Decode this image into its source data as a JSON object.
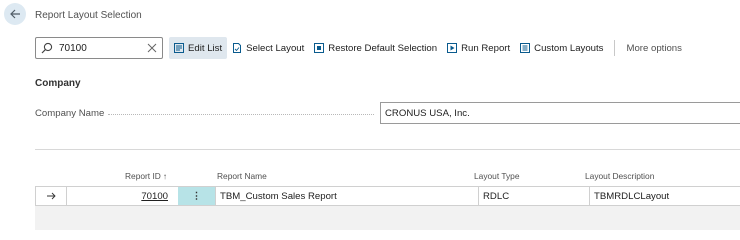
{
  "header": {
    "title": "Report Layout Selection"
  },
  "actionbar": {
    "search_value": "70100",
    "actions": {
      "edit_list": "Edit List",
      "select_layout": "Select Layout",
      "restore_default": "Restore Default Selection",
      "run_report": "Run Report",
      "custom_layouts": "Custom Layouts",
      "more_options": "More options"
    }
  },
  "company": {
    "section_title": "Company",
    "field_label": "Company Name",
    "field_value": "CRONUS USA, Inc."
  },
  "grid": {
    "columns": {
      "report_id": "Report ID",
      "sort_indicator": "↑",
      "report_name": "Report Name",
      "layout_type": "Layout Type",
      "layout_description": "Layout Description"
    },
    "rows": [
      {
        "report_id": "70100",
        "report_name": "TBM_Custom Sales Report",
        "layout_type": "RDLC",
        "layout_description": "TBMRDLCLayout"
      }
    ]
  },
  "colors": {
    "accent": "#0a5b8e",
    "selected_row_cell": "#b7e3e7",
    "active_action_bg": "#dfe7ee"
  },
  "icons": [
    "back-arrow-icon",
    "search-icon",
    "clear-icon",
    "edit-list-icon",
    "select-layout-icon",
    "restore-icon",
    "run-report-icon",
    "custom-layouts-icon",
    "row-arrow-icon",
    "row-menu-icon"
  ]
}
